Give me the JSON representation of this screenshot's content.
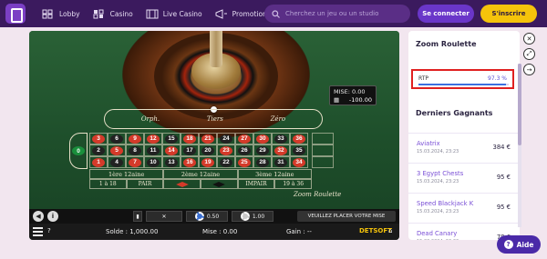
{
  "nav": {
    "items": [
      {
        "label": "Lobby",
        "icon": "lobby-grid-icon"
      },
      {
        "label": "Casino",
        "icon": "casino-grid-icon"
      },
      {
        "label": "Live Casino",
        "icon": "film-icon"
      },
      {
        "label": "Promotions",
        "icon": "megaphone-icon"
      }
    ],
    "search_placeholder": "Cherchez un jeu ou un studio",
    "login_label": "Se connecter",
    "signup_label": "S'inscrire"
  },
  "game": {
    "stats": {
      "mise_label": "MISE: 0.00",
      "result": "-100.00"
    },
    "racetrack_labels": [
      "Orph.",
      "Tiers",
      "Zéro"
    ],
    "numbers": [
      [
        "3",
        "6",
        "9",
        "12",
        "15",
        "18",
        "21",
        "24",
        "27",
        "30",
        "33",
        "36"
      ],
      [
        "2",
        "5",
        "8",
        "11",
        "14",
        "17",
        "20",
        "23",
        "26",
        "29",
        "32",
        "35"
      ],
      [
        "1",
        "4",
        "7",
        "10",
        "13",
        "16",
        "19",
        "22",
        "25",
        "28",
        "31",
        "34"
      ]
    ],
    "red_numbers": [
      "1",
      "3",
      "5",
      "7",
      "9",
      "12",
      "14",
      "16",
      "18",
      "19",
      "21",
      "23",
      "25",
      "27",
      "30",
      "32",
      "34",
      "36"
    ],
    "dozens": [
      "1ère 12aine",
      "2ème 12aine",
      "3ème 12aine"
    ],
    "outside": [
      "1 à 18",
      "PAIR",
      "",
      "",
      "IMPAIR",
      "19 à 36"
    ],
    "brand": "Zoom Roulette",
    "chip_values": [
      "0.50",
      "1.00"
    ],
    "place_message": "VEUILLEZ PLACER VOTRE MISE",
    "footer": {
      "solde": "Solde : 1,000.00",
      "mise": "Mise : 0.00",
      "gain": "Gain : --",
      "provider": "DETSOFT"
    }
  },
  "panel": {
    "title": "Zoom Roulette",
    "rtp_label": "RTP",
    "rtp_value": "97.3 %",
    "rtp_fraction": 0.973,
    "winners_title": "Derniers Gagnants",
    "winners": [
      {
        "game": "Aviatrix",
        "date": "15.03.2024, 23:23",
        "amount": "384 €"
      },
      {
        "game": "3 Egypt Chests",
        "date": "15.03.2024, 23:23",
        "amount": "95 €"
      },
      {
        "game": "Speed Blackjack K",
        "date": "15.03.2024, 23:23",
        "amount": "95 €"
      },
      {
        "game": "Dead Canary",
        "date": "15.03.2024, 23:23",
        "amount": "78 €"
      }
    ]
  },
  "side_buttons": [
    "close-icon",
    "expand-icon",
    "arrow-right-icon"
  ],
  "help": {
    "label": "Aide"
  },
  "colors": {
    "topbar": "#3b1a5e",
    "accent": "#f5c30b",
    "primary": "#6a36c9",
    "rtp_highlight": "#e02020"
  }
}
